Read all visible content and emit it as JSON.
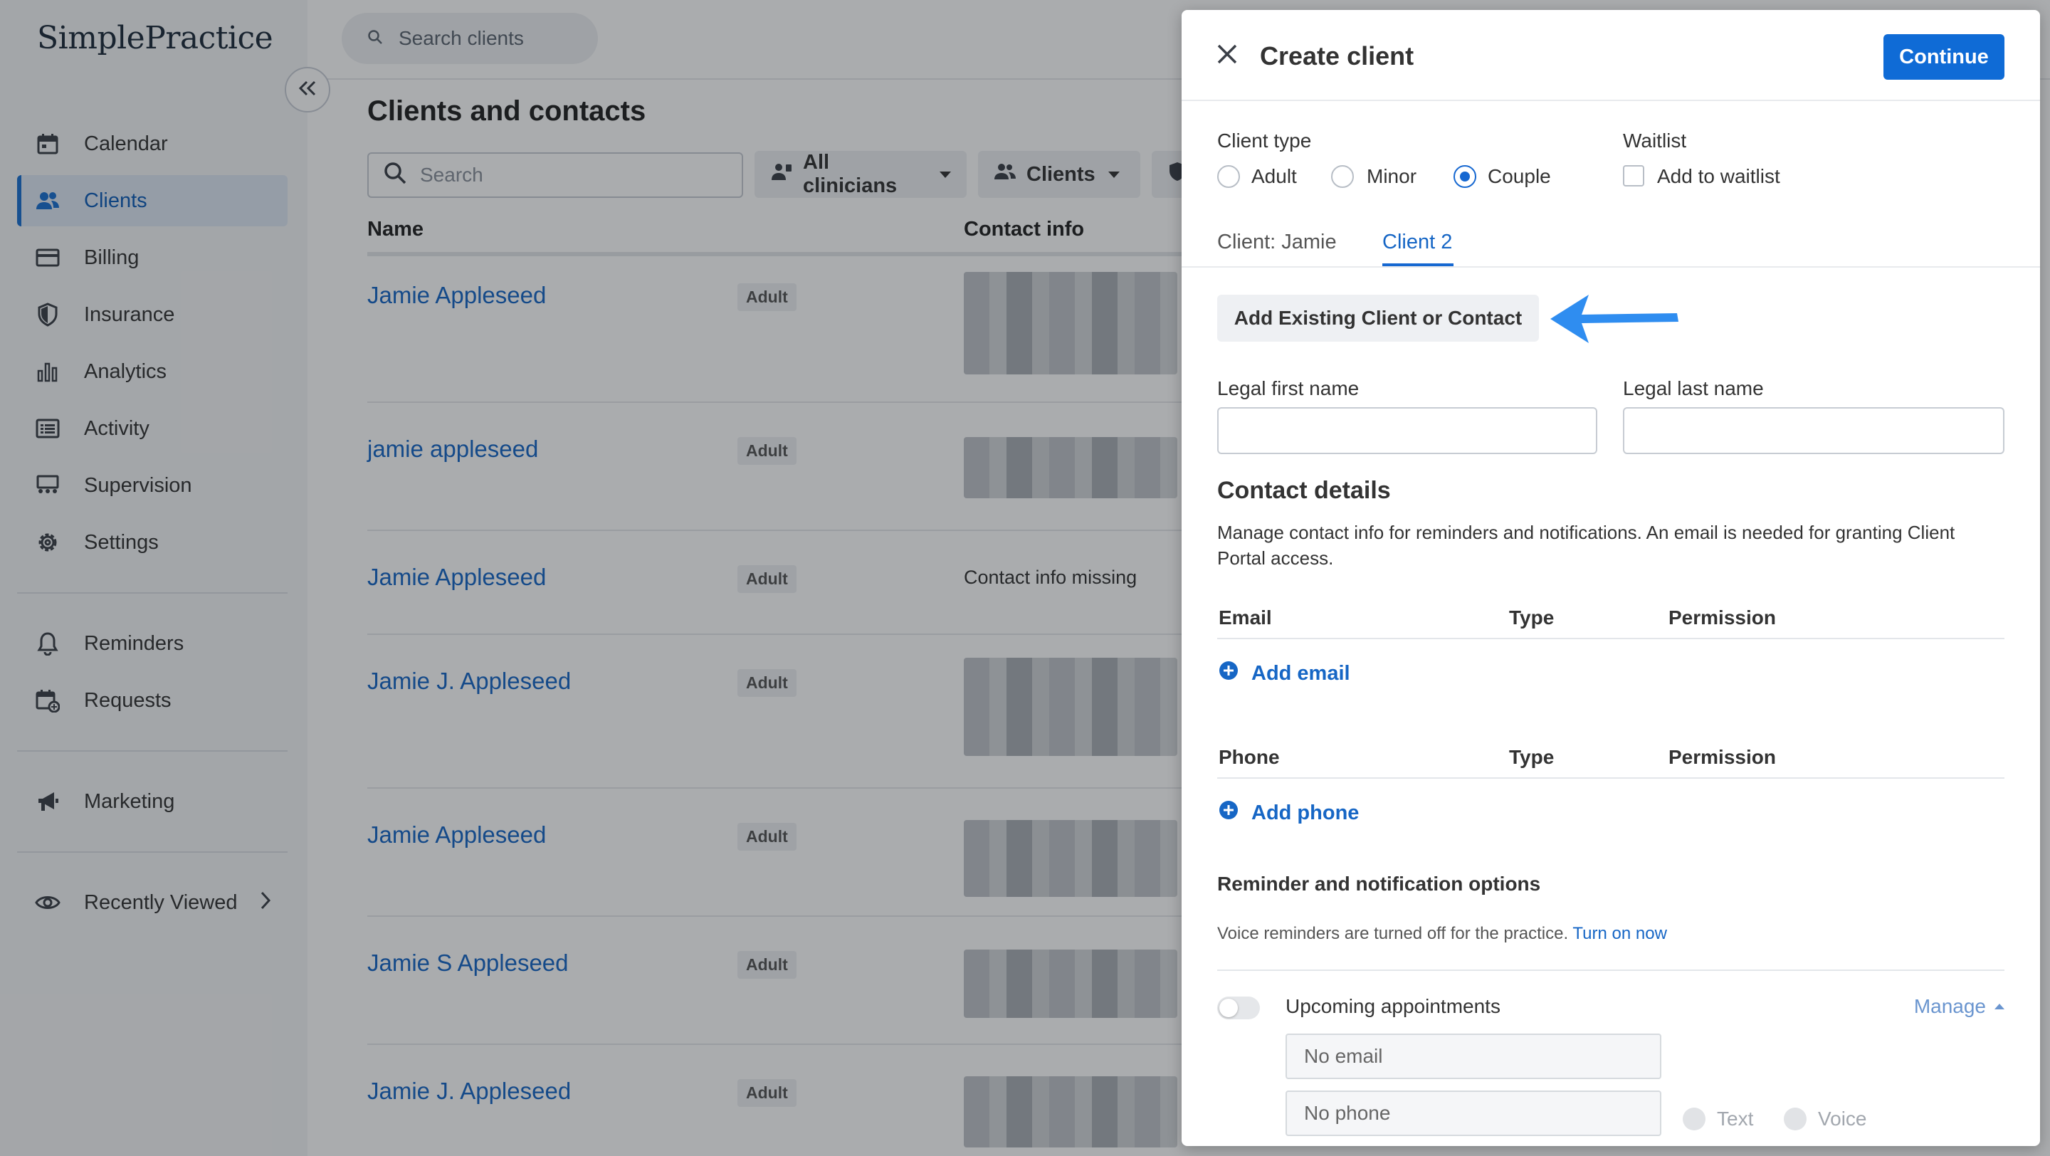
{
  "app": {
    "logo": "SimplePractice"
  },
  "sidebar": {
    "items": [
      {
        "label": "Calendar",
        "icon": "calendar-icon",
        "active": false
      },
      {
        "label": "Clients",
        "icon": "users-icon",
        "active": true
      },
      {
        "label": "Billing",
        "icon": "credit-card-icon",
        "active": false
      },
      {
        "label": "Insurance",
        "icon": "shield-icon",
        "active": false
      },
      {
        "label": "Analytics",
        "icon": "bar-chart-icon",
        "active": false
      },
      {
        "label": "Activity",
        "icon": "list-icon",
        "active": false
      },
      {
        "label": "Supervision",
        "icon": "supervision-icon",
        "active": false
      },
      {
        "label": "Settings",
        "icon": "gear-icon",
        "active": false
      }
    ],
    "secondary": [
      {
        "label": "Reminders",
        "icon": "bell-icon"
      },
      {
        "label": "Requests",
        "icon": "calendar-plus-icon"
      }
    ],
    "marketing": {
      "label": "Marketing",
      "icon": "megaphone-icon"
    },
    "recently_viewed": {
      "label": "Recently Viewed",
      "icon": "eye-icon"
    }
  },
  "topbar": {
    "search_placeholder": "Search clients"
  },
  "clients_page": {
    "title": "Clients and contacts",
    "search_placeholder": "Search",
    "filters": {
      "clinicians": "All clinicians",
      "clients": "Clients"
    },
    "columns": {
      "name": "Name",
      "contact": "Contact info"
    },
    "rows": [
      {
        "name": "Jamie Appleseed",
        "badge": "Adult",
        "contact": ""
      },
      {
        "name": "jamie appleseed",
        "badge": "Adult",
        "contact": ""
      },
      {
        "name": "Jamie Appleseed",
        "badge": "Adult",
        "contact": "Contact info missing"
      },
      {
        "name": "Jamie J. Appleseed",
        "badge": "Adult",
        "contact": ""
      },
      {
        "name": "Jamie Appleseed",
        "badge": "Adult",
        "contact": ""
      },
      {
        "name": "Jamie S Appleseed",
        "badge": "Adult",
        "contact": ""
      },
      {
        "name": "Jamie J. Appleseed",
        "badge": "Adult",
        "contact": ""
      }
    ]
  },
  "modal": {
    "title": "Create client",
    "continue": "Continue",
    "client_type": {
      "label": "Client type",
      "options": [
        "Adult",
        "Minor",
        "Couple"
      ],
      "selected": "Couple"
    },
    "waitlist": {
      "label": "Waitlist",
      "checkbox": "Add to waitlist",
      "checked": false
    },
    "tabs": [
      {
        "label": "Client: Jamie",
        "active": false
      },
      {
        "label": "Client 2",
        "active": true
      }
    ],
    "add_existing": "Add Existing Client or Contact",
    "first_name": {
      "label": "Legal first name",
      "value": ""
    },
    "last_name": {
      "label": "Legal last name",
      "value": ""
    },
    "contact_details": {
      "title": "Contact details",
      "description": "Manage contact info for reminders and notifications. An email is needed for granting Client Portal access.",
      "email_cols": {
        "a": "Email",
        "b": "Type",
        "c": "Permission"
      },
      "add_email": "Add email",
      "phone_cols": {
        "a": "Phone",
        "b": "Type",
        "c": "Permission"
      },
      "add_phone": "Add phone"
    },
    "reminders": {
      "title": "Reminder and notification options",
      "voice_note": "Voice reminders are turned off for the practice.",
      "turn_on": "Turn on now",
      "upcoming": "Upcoming appointments",
      "upcoming_on": false,
      "manage": "Manage",
      "no_email": "No email",
      "no_phone": "No phone",
      "text": "Text",
      "voice": "Voice"
    }
  },
  "colors": {
    "accent": "#1668d1",
    "link": "#1666c5",
    "arrow": "#2f8df0"
  }
}
